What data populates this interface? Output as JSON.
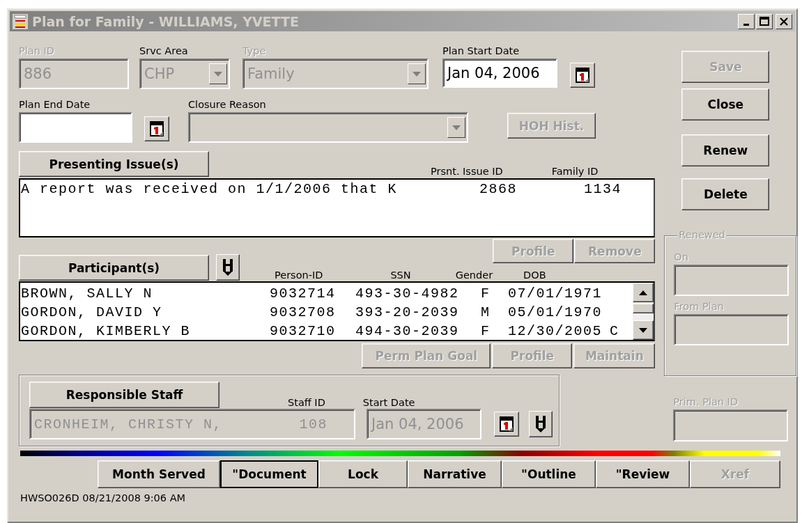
{
  "window": {
    "title": "Plan for Family - WILLIAMS, YVETTE"
  },
  "plan_id": {
    "label": "Plan ID",
    "value": "886",
    "disabled": true
  },
  "srvc_area": {
    "label": "Srvc Area",
    "value": "CHP",
    "disabled": true
  },
  "type": {
    "label": "Type",
    "value": "Family",
    "disabled": true
  },
  "plan_start_date": {
    "label": "Plan Start Date",
    "value": "Jan 04, 2006",
    "disabled": false
  },
  "plan_end_date": {
    "label": "Plan End Date",
    "disabled": false
  },
  "closure_reason": {
    "label": "Closure Reason",
    "disabled": true
  },
  "hoh_button": {
    "label": "HOH Hist.",
    "disabled": true
  },
  "side_buttons": [
    {
      "label": "Save",
      "disabled": true
    },
    {
      "label": "Close",
      "disabled": false
    },
    {
      "label": "Renew",
      "disabled": false
    },
    {
      "label": "Delete",
      "disabled": false
    }
  ],
  "presenting_issues": {
    "button": "Presenting Issue(s)",
    "columns": [
      "Prsnt. Issue ID",
      "Family ID"
    ],
    "rows": [
      {
        "text": "A report was received on 1/1/2006 that K",
        "issue_id": "2868",
        "family_id": "1134"
      }
    ],
    "buttons": [
      {
        "label": "Profile",
        "disabled": true
      },
      {
        "label": "Remove",
        "disabled": true
      }
    ]
  },
  "participants": {
    "button": "Participant(s)",
    "columns": [
      "Person-ID",
      "SSN",
      "Gender",
      "DOB"
    ],
    "rows": [
      {
        "name": "BROWN, SALLY N",
        "person_id": "9032714",
        "ssn": "493-30-4982",
        "gender": "F",
        "dob": "07/01/1971"
      },
      {
        "name": "GORDON, DAVID Y",
        "person_id": "9032708",
        "ssn": "393-20-2039",
        "gender": "M",
        "dob": "05/01/1970"
      },
      {
        "name": "GORDON, KIMBERLY B",
        "person_id": "9032710",
        "ssn": "494-30-2039",
        "gender": "F",
        "dob": "12/30/2005",
        "column_6": "C"
      }
    ],
    "buttons": [
      {
        "label": "Perm Plan Goal",
        "disabled": true
      },
      {
        "label": "Profile",
        "disabled": true
      },
      {
        "label": "Maintain",
        "disabled": true
      }
    ]
  },
  "staff": {
    "button": "Responsible Staff",
    "staff_id_label": "Staff ID",
    "start_date_label": "Start Date",
    "name": "CRONHEIM, CHRISTY N,",
    "staff_id": "108",
    "start_date": "Jan 04, 2006",
    "disabled": true
  },
  "renewed": {
    "title": "Renewed",
    "on_label": "On",
    "from_plan_label": "From Plan"
  },
  "prim_plan_id": {
    "label": "Prim. Plan ID"
  },
  "bottom_buttons": [
    {
      "label": "Month Served",
      "disabled": false,
      "focused": false
    },
    {
      "label": "\"Document",
      "disabled": false,
      "focused": true
    },
    {
      "label": "Lock",
      "disabled": false,
      "focused": false
    },
    {
      "label": "Narrative",
      "disabled": false,
      "focused": false
    },
    {
      "label": "\"Outline",
      "disabled": false,
      "focused": false
    },
    {
      "label": "\"Review",
      "disabled": false,
      "focused": false
    },
    {
      "label": "Xref",
      "disabled": true,
      "focused": false
    }
  ],
  "status_bar": "HWSO026D 08/21/2008  9:06 AM"
}
